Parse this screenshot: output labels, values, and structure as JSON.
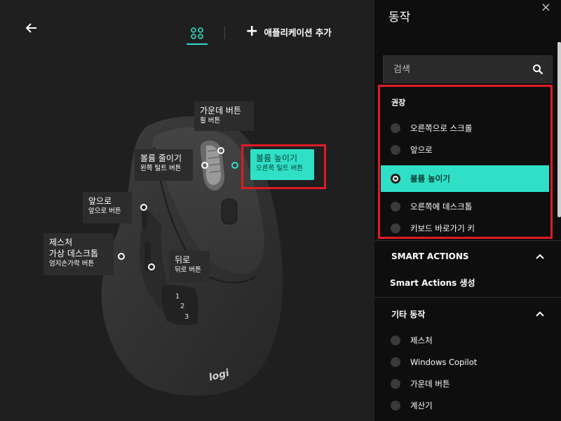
{
  "header": {
    "add_app_label": "애플리케이션 추가"
  },
  "mouse": {
    "logo": "logi",
    "side_numbers": [
      "1",
      "2",
      "3"
    ]
  },
  "callouts": {
    "middle": {
      "title": "가운데 버튼",
      "sub": "휠 버튼"
    },
    "vol_down": {
      "title": "볼륨 줄이기",
      "sub": "왼쪽 틸트 버튼"
    },
    "vol_up": {
      "title": "볼륨 높이기",
      "sub": "오른쪽 틸트 버튼"
    },
    "forward": {
      "title": "앞으로",
      "sub": "앞으로 버튼"
    },
    "gesture": {
      "title": "제스처",
      "title2": "가상 데스크톱",
      "sub": "엄지손가락 버튼"
    },
    "back": {
      "title": "뒤로",
      "sub": "뒤로 버튼"
    }
  },
  "panel": {
    "title": "동작",
    "close": "×",
    "search_placeholder": "검색",
    "recommended_title": "권장",
    "recommended": [
      {
        "label": "오른쪽으로 스크롤",
        "selected": false
      },
      {
        "label": "앞으로",
        "selected": false
      },
      {
        "label": "볼륨 높이기",
        "selected": true
      },
      {
        "label": "오른쪽에 데스크톱",
        "selected": false
      },
      {
        "label": "키보드 바로가기 키",
        "selected": false
      }
    ],
    "smart_actions_title": "SMART ACTIONS",
    "smart_actions_create": "Smart Actions 생성",
    "other_title": "기타 동작",
    "other": [
      {
        "label": "제스처"
      },
      {
        "label": "Windows Copilot"
      },
      {
        "label": "가운데 버튼"
      },
      {
        "label": "계산기"
      }
    ]
  },
  "colors": {
    "accent": "#2fe0c6",
    "highlight_box": "#e01b24",
    "panel_bg": "#0e0e0e",
    "main_bg": "#1f1f1f"
  }
}
